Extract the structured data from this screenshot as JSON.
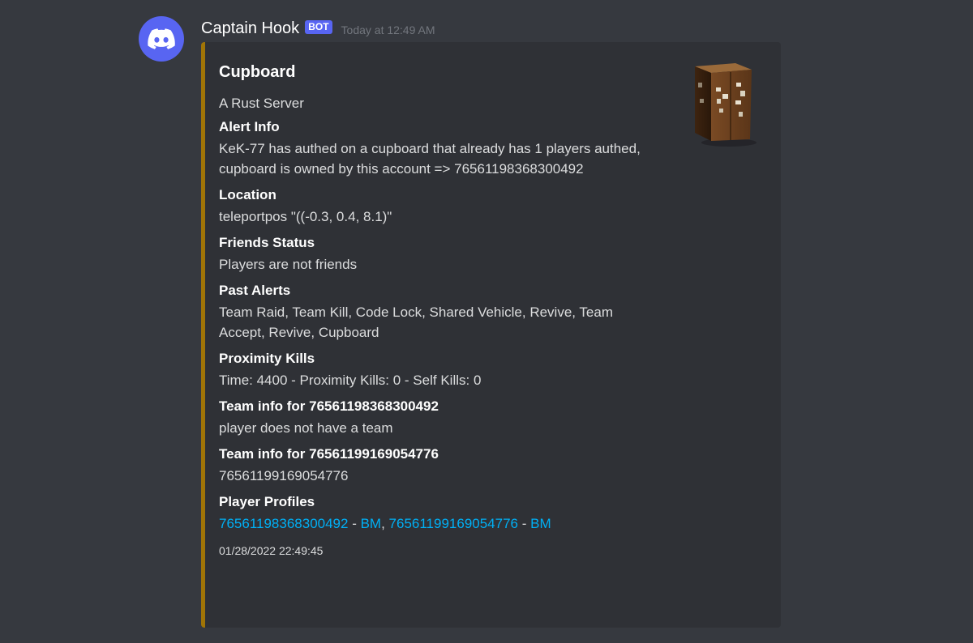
{
  "author": {
    "name": "Captain Hook",
    "bot_tag": "BOT",
    "timestamp": "Today at 12:49 AM"
  },
  "embed": {
    "accent_color": "#a07406",
    "thumbnail_icon": "cupboard-image",
    "title": "Cupboard",
    "description": "A Rust Server",
    "fields": [
      {
        "name": "Alert Info",
        "value": "KeK-77 has authed on a cupboard that already has 1 players authed, cupboard is owned by this account => 76561198368300492"
      },
      {
        "name": "Location",
        "value": "teleportpos \"((-0.3, 0.4, 8.1)\""
      },
      {
        "name": "Friends Status",
        "value": "Players are not friends"
      },
      {
        "name": "Past Alerts",
        "value": "Team Raid, Team Kill, Code Lock, Shared Vehicle, Revive, Team Accept, Revive, Cupboard"
      },
      {
        "name": "Proximity Kills",
        "value": "Time: 4400 - Proximity Kills: 0 - Self Kills: 0"
      },
      {
        "name": "Team info for 76561198368300492",
        "value": "player does not have a team"
      },
      {
        "name": "Team info for 76561199169054776",
        "value": "76561199169054776"
      }
    ],
    "profiles": {
      "name": "Player Profiles",
      "link1": "76561198368300492",
      "sep1": " - ",
      "link2": "BM",
      "comma": ", ",
      "link3": "76561199169054776",
      "sep2": " - ",
      "link4": "BM"
    },
    "footer": "01/28/2022 22:49:45"
  },
  "colors": {
    "background": "#36393f",
    "embed_background": "#2f3136",
    "blurple": "#5865f2",
    "link": "#00aff4"
  }
}
